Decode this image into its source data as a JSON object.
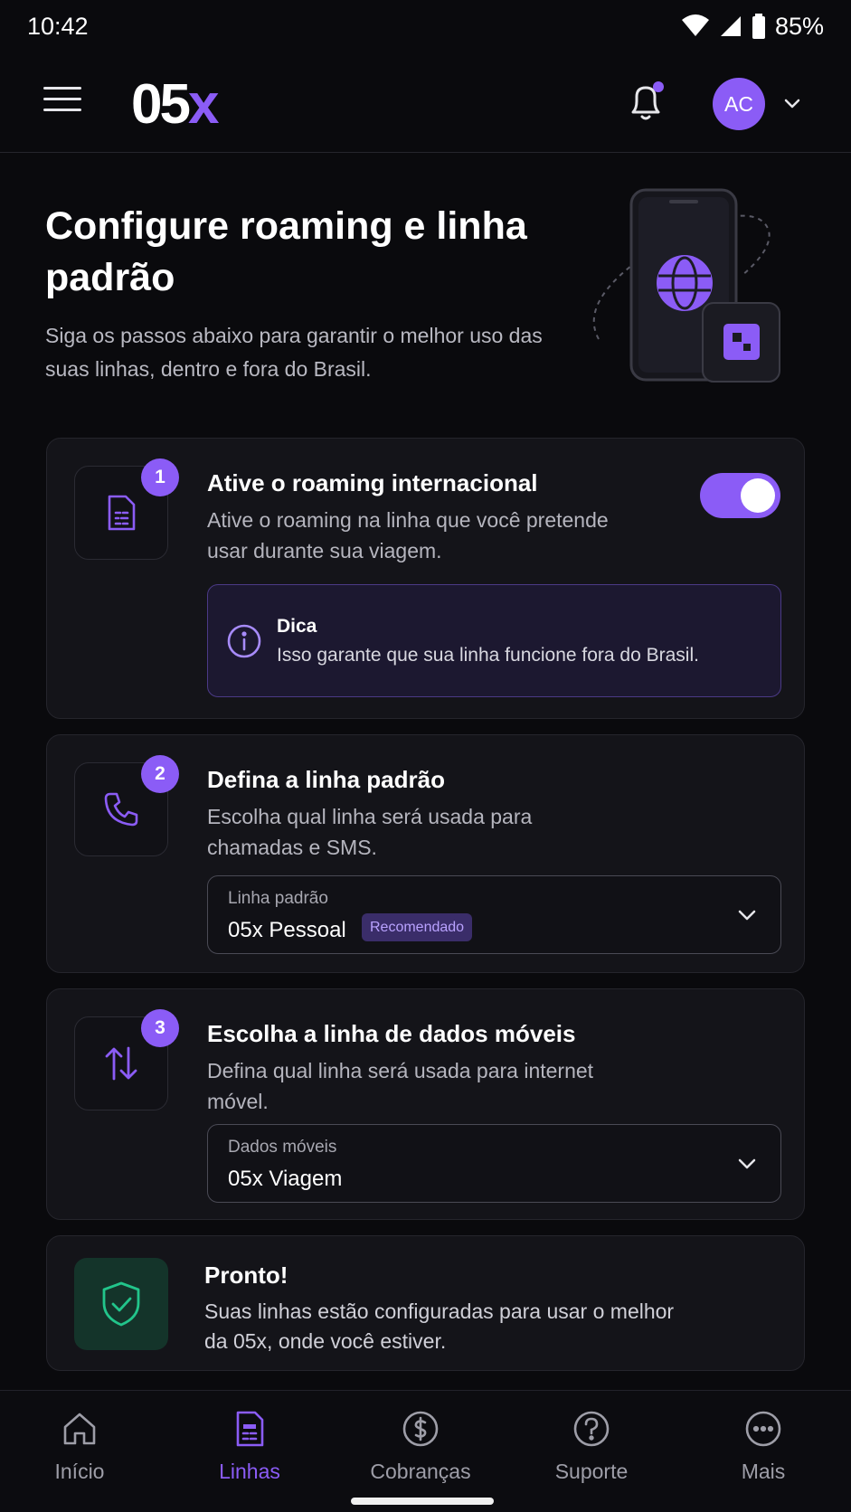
{
  "status_bar": {
    "time": "10:42",
    "battery": "85%"
  },
  "header": {
    "logo_main": "05",
    "logo_accent": "x",
    "avatar_initials": "AC"
  },
  "hero": {
    "title": "Configure roaming e linha padrão",
    "subtitle": "Siga os passos abaixo para garantir o melhor uso das suas linhas, dentro e fora do Brasil."
  },
  "steps": [
    {
      "number": "1",
      "title": "Ative o roaming internacional",
      "description": "Ative o roaming na linha que você pretende usar durante sua viagem.",
      "toggle_on": true,
      "tip": {
        "title": "Dica",
        "text": "Isso garante que sua linha funcione fora do Brasil."
      }
    },
    {
      "number": "2",
      "title": "Defina a linha padrão",
      "description": "Escolha qual linha será usada para chamadas e SMS.",
      "select": {
        "label": "Linha padrão",
        "value": "05x Pessoal",
        "badge": "Recomendado"
      }
    },
    {
      "number": "3",
      "title": "Escolha a linha de dados móveis",
      "description": "Defina qual linha será usada para internet móvel.",
      "select": {
        "label": "Dados móveis",
        "value": "05x Viagem"
      }
    }
  ],
  "done": {
    "title": "Pronto!",
    "text": "Suas linhas estão configuradas para usar o melhor da 05x, onde você estiver."
  },
  "bottom_nav": [
    {
      "label": "Início",
      "icon": "home-icon",
      "active": false
    },
    {
      "label": "Linhas",
      "icon": "lines-icon",
      "active": true
    },
    {
      "label": "Cobranças",
      "icon": "dollar-icon",
      "active": false
    },
    {
      "label": "Suporte",
      "icon": "help-icon",
      "active": false
    },
    {
      "label": "Mais",
      "icon": "more-icon",
      "active": false
    }
  ],
  "colors": {
    "accent": "#8b5cf6",
    "background": "#0a0a0d",
    "card": "#141419",
    "success": "#22c58b"
  }
}
